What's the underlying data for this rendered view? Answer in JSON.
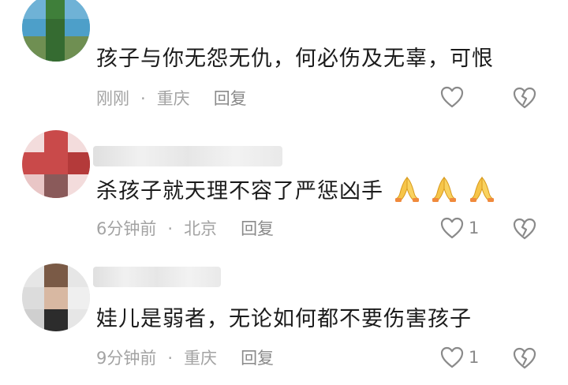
{
  "comments": [
    {
      "text": "孩子与你无怨无仇，何必伤及无辜，可恨",
      "time": "刚刚",
      "separator": "·",
      "location": "重庆",
      "reply_label": "回复",
      "like_count": ""
    },
    {
      "text": "杀孩子就天理不容了严惩凶手",
      "emoji": "🙏🙏🙏",
      "time": "6分钟前",
      "separator": "·",
      "location": "北京",
      "reply_label": "回复",
      "like_count": "1"
    },
    {
      "text": "娃儿是弱者，无论如何都不要伤害孩子",
      "time": "9分钟前",
      "separator": "·",
      "location": "重庆",
      "reply_label": "回复",
      "like_count": "1"
    }
  ],
  "colors": {
    "text": "#1b1b1b",
    "meta": "#a3a3a3",
    "icon": "#8a8a8a"
  }
}
